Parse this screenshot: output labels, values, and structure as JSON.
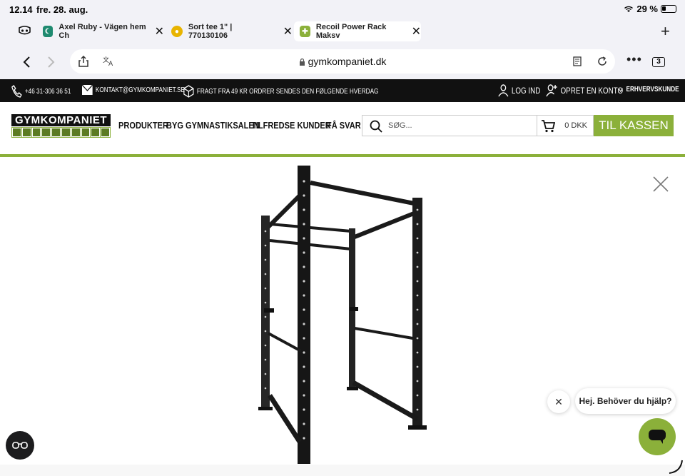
{
  "status": {
    "time": "12.14",
    "date": "fre. 28. aug.",
    "battery": "29 %"
  },
  "tabs": [
    {
      "title": "Axel Ruby - Vägen hem Ch",
      "fav_color": "#1f8a70",
      "fav_glyph": "☾"
    },
    {
      "title": "Sort tee 1\" | 770130106",
      "fav_color": "#e8b400",
      "fav_glyph": "●"
    },
    {
      "title": "Recoil Power Rack Maksv",
      "fav_color": "#8bb03a",
      "fav_glyph": "✚"
    }
  ],
  "url": {
    "domain": "gymkompaniet.dk",
    "tab_count": "3"
  },
  "topbar": {
    "phone": "+46 31-306 36 51",
    "email": "KONTAKT@GYMKOMPANIET.SE",
    "shipping": "FRAGT FRA 49 KR ORDRER SENDES DEN FØLGENDE HVERDAG",
    "login": "LOG IND",
    "create_account": "OPRET EN KONTO",
    "business": "ERHVERVSKUNDE"
  },
  "header": {
    "logo": "GYMKOMPANIET",
    "nav": [
      "PRODUKTER",
      "BYG GYMNASTIKSALEN",
      "TILFREDSE KUNDER",
      "FÅ SVAR"
    ],
    "search_placeholder": "SØG...",
    "cart_amount": "0 DKK",
    "checkout": "TIL KASSEN"
  },
  "chat": {
    "greeting": "Hej. Behöver du hjälp?"
  },
  "colors": {
    "brand_green": "#8bb03a",
    "topbar_black": "#111111"
  }
}
